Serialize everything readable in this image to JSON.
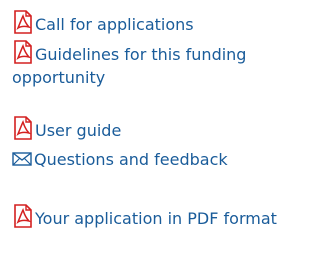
{
  "colors": {
    "link": "#1a5c9a",
    "pdf_icon": "#d42020"
  },
  "links": [
    {
      "label": "Call for applications",
      "icon": "pdf-icon"
    },
    {
      "label": "Guidelines for this funding opportunity",
      "icon": "pdf-icon"
    },
    {
      "label": "User guide",
      "icon": "pdf-icon"
    },
    {
      "label": "Questions and feedback",
      "icon": "envelope-icon"
    },
    {
      "label": "Your application in PDF format",
      "icon": "pdf-icon"
    }
  ]
}
